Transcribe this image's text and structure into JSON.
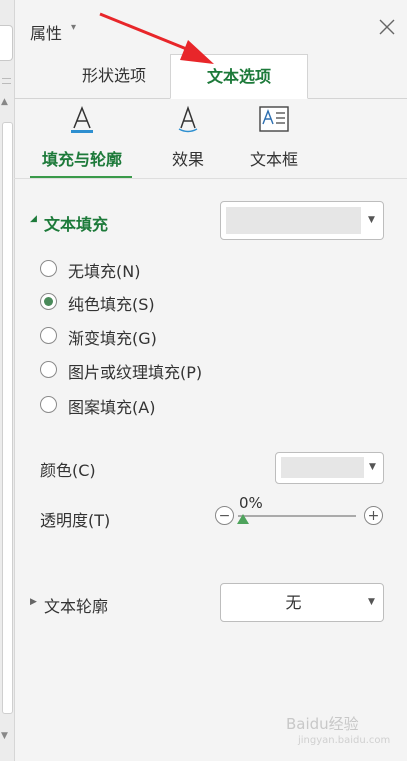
{
  "panel": {
    "title": "属性",
    "title_caret": "▾",
    "close_icon": "close-icon"
  },
  "tabs": [
    {
      "label": "形状选项",
      "active": false
    },
    {
      "label": "文本选项",
      "active": true
    }
  ],
  "subtabs": [
    {
      "label": "填充与轮廓",
      "icon": "text-fill-icon",
      "active": true
    },
    {
      "label": "效果",
      "icon": "text-effect-icon",
      "active": false
    },
    {
      "label": "文本框",
      "icon": "text-box-icon",
      "active": false
    }
  ],
  "text_fill": {
    "title": "文本填充",
    "options": [
      {
        "label": "无填充(N)",
        "selected": false
      },
      {
        "label": "纯色填充(S)",
        "selected": true
      },
      {
        "label": "渐变填充(G)",
        "selected": false
      },
      {
        "label": "图片或纹理填充(P)",
        "selected": false
      },
      {
        "label": "图案填充(A)",
        "selected": false
      }
    ],
    "color_label": "颜色(C)",
    "transparency_label": "透明度(T)",
    "transparency_value": "0%",
    "minus": "−",
    "plus": "+"
  },
  "text_outline": {
    "title": "文本轮廓",
    "value": "无"
  },
  "colors": {
    "accent": "#1d7a3a",
    "arrow": "#e8262a"
  },
  "watermark": {
    "line1": "Baidu经验",
    "line2": "jingyan.baidu.com"
  }
}
